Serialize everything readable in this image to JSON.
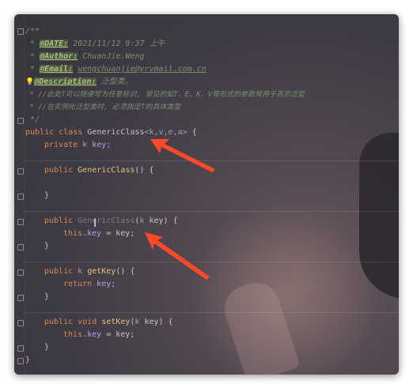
{
  "editor": {
    "lines": {
      "l1": "/**",
      "l2_prefix": " * ",
      "l2_tag": "@DATE:",
      "l2_text": " 2021/11/12 9:37 上午",
      "l3_tag": "@Author:",
      "l3_text": " ChuanJie.Weng",
      "l4_tag": "@Email:",
      "l4_text": "wengchuanjie@yrvmail.com.cn",
      "l5_tag": "@Description:",
      "l5_text": " 泛型类、",
      "l6": " * //此处T可以随便写为任意标识, 常见的如T、E、K、V等形式的参数常用于表示泛型",
      "l7": " * //在实例化泛型类时, 必须指定T的具体类型",
      "l8": " */",
      "l9_kw": "public class ",
      "l9_name": "GenericClass",
      "l9_generics": "<k,v,e,a>",
      "l9_end": " {",
      "l10_kw": "private ",
      "l10_type": "k ",
      "l10_field": "key;",
      "l11_kw": "public ",
      "l11_name": "GenericClass",
      "l11_end": "() {",
      "l12": "}",
      "l13_kw": "public ",
      "l13_name": "GenericClass",
      "l13_paren": "(",
      "l13_type": "k ",
      "l13_param": "key",
      "l13_end": ") {",
      "l14_this": "this",
      "l14_field": ".key",
      "l14_end": " = key;",
      "l15": "}",
      "l16_kw": "public ",
      "l16_type": "k ",
      "l16_name": "getKey",
      "l16_end": "() {",
      "l17_kw": "return ",
      "l17_end": "key;",
      "l18": "}",
      "l19_kw": "public void ",
      "l19_name": "setKey",
      "l19_paren": "(",
      "l19_type": "k ",
      "l19_end": "key) {",
      "l20_this": "this",
      "l20_field": ".key",
      "l20_end": " = key;",
      "l21": "}",
      "l22": "}"
    },
    "bulb_icon": "💡",
    "cursor_glyph": "I"
  },
  "colors": {
    "annotation_arrow": "#ff4a2a"
  }
}
